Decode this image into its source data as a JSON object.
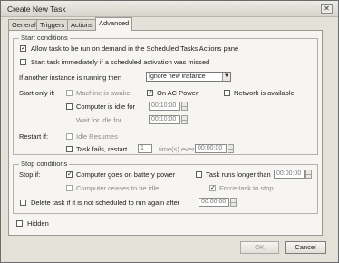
{
  "window": {
    "title": "Create New Task",
    "close_glyph": "✕"
  },
  "tabs": [
    {
      "label": "General",
      "active": false
    },
    {
      "label": "Triggers",
      "active": false
    },
    {
      "label": "Actions",
      "active": false
    },
    {
      "label": "Advanced",
      "active": true
    }
  ],
  "start_conditions": {
    "group_label": "Start conditions",
    "allow_demand": {
      "label": "Allow task to be run on demand in the Scheduled Tasks Actions pane",
      "checked": true
    },
    "start_immediately": {
      "label": "Start task immediately if a scheduled activation was missed",
      "checked": false
    },
    "instance_label": "If another instance is running then",
    "instance_value": "Ignore new instance",
    "start_only_if_label": "Start only if:",
    "machine_awake": {
      "label": "Machine is awake",
      "checked": false
    },
    "on_ac_power": {
      "label": "On AC Power",
      "checked": true
    },
    "network_available": {
      "label": "Network is available",
      "checked": false
    },
    "computer_idle": {
      "label": "Computer is idle for",
      "checked": false,
      "value": "00:10:00"
    },
    "wait_for_idle": {
      "label": "Wait for idle for",
      "value": "00:10:00"
    },
    "restart_if_label": "Restart if:",
    "idle_resumes": {
      "label": "Idle Resumes",
      "checked": false
    },
    "task_fails": {
      "label": "Task fails, restart",
      "checked": false,
      "count": "1",
      "times_label": "time(s) every",
      "every_value": "00:00:00"
    }
  },
  "stop_conditions": {
    "group_label": "Stop conditions",
    "stop_if_label": "Stop if:",
    "on_battery": {
      "label": "Computer goes on battery power",
      "checked": true
    },
    "task_runs_longer": {
      "label": "Task runs longer than",
      "checked": false,
      "value": "00:00:00"
    },
    "ceases_idle": {
      "label": "Computer ceases to be idle",
      "checked": false
    },
    "force_stop": {
      "label": "Force task to stop",
      "checked": true
    },
    "delete_task": {
      "label": "Delete task if it is not scheduled to run again after",
      "checked": false,
      "value": "00:00:00"
    }
  },
  "hidden": {
    "label": "Hidden",
    "checked": false
  },
  "buttons": {
    "ok": "OK",
    "cancel": "Cancel"
  }
}
